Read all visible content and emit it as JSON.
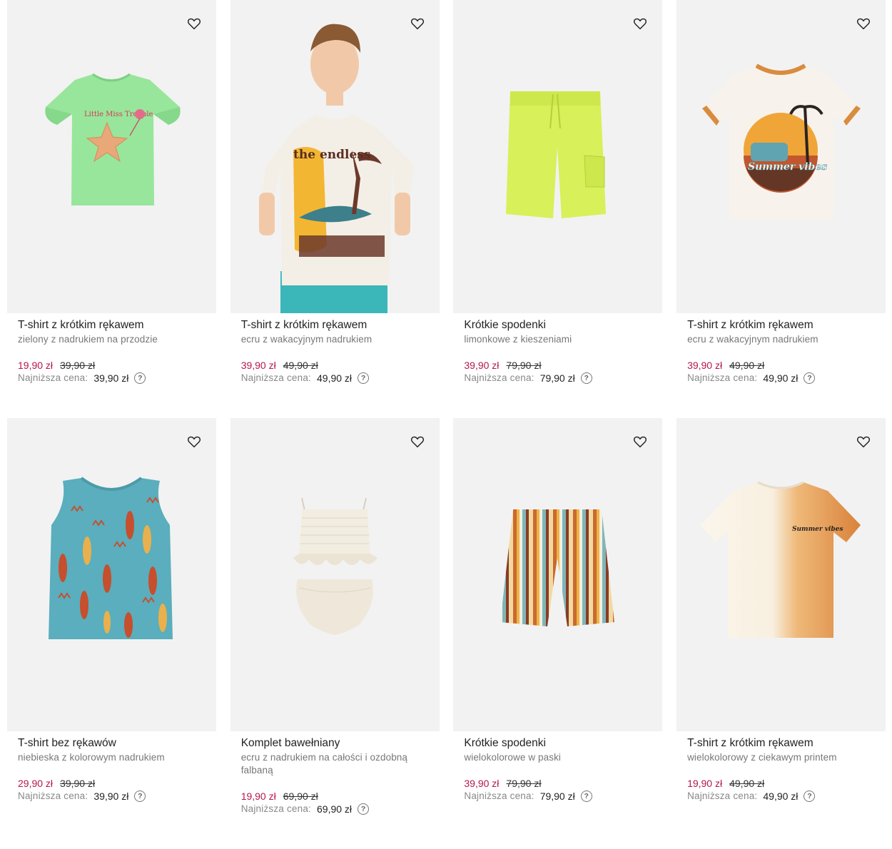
{
  "products": [
    {
      "name": "T-shirt z krótkim rękawem",
      "desc": "zielony z nadrukiem na przodzie",
      "price": "19,90 zł",
      "old_price": "39,90 zł",
      "lowest_label": "Najniższa cena:",
      "lowest": "39,90 zł",
      "image": "green-tshirt-starfish",
      "print_text": "Little Miss Trouble"
    },
    {
      "name": "T-shirt z krótkim rękawem",
      "desc": "ecru z wakacyjnym nadrukiem",
      "price": "39,90 zł",
      "old_price": "49,90 zł",
      "lowest_label": "Najniższa cena:",
      "lowest": "49,90 zł",
      "image": "boy-in-printed-tshirt",
      "print_text": "the endless"
    },
    {
      "name": "Krótkie spodenki",
      "desc": "limonkowe z kieszeniami",
      "price": "39,90 zł",
      "old_price": "79,90 zł",
      "lowest_label": "Najniższa cena:",
      "lowest": "79,90 zł",
      "image": "lime-shorts"
    },
    {
      "name": "T-shirt z krótkim rękawem",
      "desc": "ecru z wakacyjnym nadrukiem",
      "price": "39,90 zł",
      "old_price": "49,90 zł",
      "lowest_label": "Najniższa cena:",
      "lowest": "49,90 zł",
      "image": "ecru-tshirt-sunset",
      "print_text": "Summer vibes"
    },
    {
      "name": "T-shirt bez rękawów",
      "desc": "niebieska z kolorowym nadrukiem",
      "price": "29,90 zł",
      "old_price": "39,90 zł",
      "lowest_label": "Najniższa cena:",
      "lowest": "39,90 zł",
      "image": "blue-tank-surfboards"
    },
    {
      "name": "Komplet bawełniany",
      "desc": "ecru z nadrukiem na całości i ozdobną falbaną",
      "price": "19,90 zł",
      "old_price": "69,90 zł",
      "lowest_label": "Najniższa cena:",
      "lowest": "69,90 zł",
      "image": "ecru-cotton-set"
    },
    {
      "name": "Krótkie spodenki",
      "desc": "wielokolorowe w paski",
      "price": "39,90 zł",
      "old_price": "79,90 zł",
      "lowest_label": "Najniższa cena:",
      "lowest": "79,90 zł",
      "image": "striped-shorts"
    },
    {
      "name": "T-shirt z krótkim rękawem",
      "desc": "wielokolorowy z ciekawym printem",
      "price": "19,90 zł",
      "old_price": "49,90 zł",
      "lowest_label": "Najniższa cena:",
      "lowest": "49,90 zł",
      "image": "ombre-orange-tshirt",
      "print_text": "Summer vibes"
    }
  ],
  "icons": {
    "favorite": "heart-outline-icon",
    "help": "question-circle-icon"
  },
  "help_glyph": "?",
  "colors": {
    "sale": "#b5174a",
    "card_bg": "#f2f2f2"
  }
}
